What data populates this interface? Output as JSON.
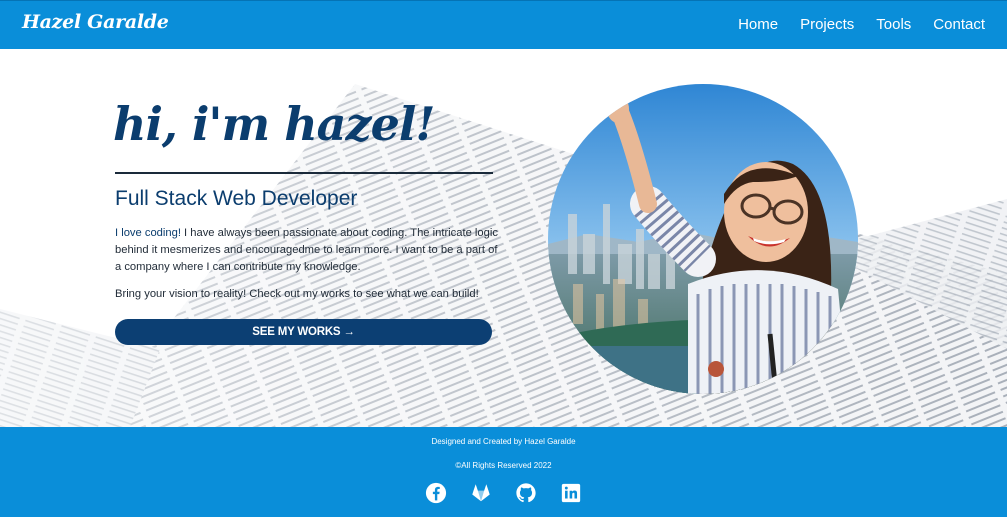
{
  "brand": "Hazel Garalde",
  "nav": {
    "items": [
      "Home",
      "Projects",
      "Tools",
      "Contact"
    ]
  },
  "hero": {
    "title": "hi, i'm hazel!",
    "subtitle": "Full Stack Web Developer",
    "para1_accent": "I love coding!",
    "para1_rest": " I have always been passionate about coding. The intricate logic behind it mesmerizes and encouragedme to learn more. I want to be a part of a company where I can contribute my knowledge.",
    "para2": "Bring your vision to reality! Check out my works to see what we can build!",
    "cta_label": "SEE MY WORKS",
    "cta_arrow": "→"
  },
  "footer": {
    "credit": "Designed and Created by Hazel Garalde",
    "copyright": "©All Rights Reserved 2022",
    "socials": [
      "facebook-icon",
      "gitlab-icon",
      "github-icon",
      "linkedin-icon"
    ]
  },
  "colors": {
    "primary_blue": "#0a8ed9",
    "navy": "#0b3d6e",
    "button_navy": "#0c3f73"
  }
}
